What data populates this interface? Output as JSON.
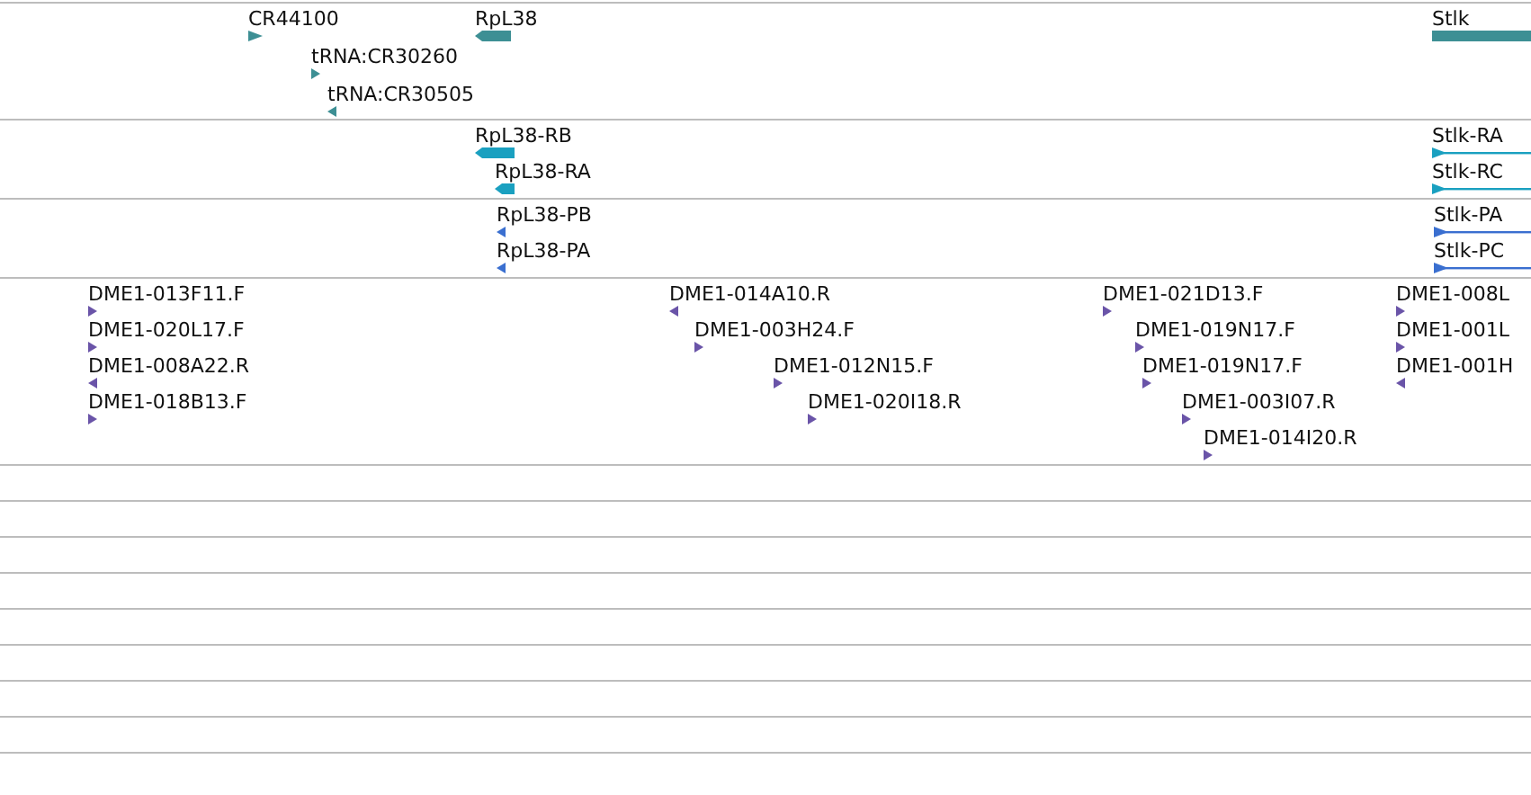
{
  "tracks": [
    {
      "kind": "gene",
      "features": [
        {
          "label": "CR44100",
          "forward": true
        },
        {
          "label": "RpL38",
          "forward": false
        },
        {
          "label": "tRNA:CR30260",
          "forward": true
        },
        {
          "label": "tRNA:CR30505",
          "forward": false
        },
        {
          "label": "Stlk",
          "forward": true
        }
      ]
    },
    {
      "kind": "transcript",
      "features": [
        {
          "label": "RpL38-RB",
          "forward": false
        },
        {
          "label": "RpL38-RA",
          "forward": false
        },
        {
          "label": "Stlk-RA",
          "forward": true
        },
        {
          "label": "Stlk-RC",
          "forward": true
        }
      ]
    },
    {
      "kind": "protein",
      "features": [
        {
          "label": "RpL38-PB",
          "forward": false
        },
        {
          "label": "RpL38-PA",
          "forward": false
        },
        {
          "label": "Stlk-PA",
          "forward": true
        },
        {
          "label": "Stlk-PC",
          "forward": true
        }
      ]
    },
    {
      "kind": "clone",
      "features": [
        {
          "label": "DME1-013F11.F",
          "forward": true
        },
        {
          "label": "DME1-020L17.F",
          "forward": true
        },
        {
          "label": "DME1-008A22.R",
          "forward": false
        },
        {
          "label": "DME1-018B13.F",
          "forward": true
        },
        {
          "label": "DME1-014A10.R",
          "forward": false
        },
        {
          "label": "DME1-003H24.F",
          "forward": true
        },
        {
          "label": "DME1-012N15.F",
          "forward": true
        },
        {
          "label": "DME1-020I18.R",
          "forward": true
        },
        {
          "label": "DME1-021D13.F",
          "forward": true
        },
        {
          "label": "DME1-019N17.F",
          "forward": true
        },
        {
          "label": "DME1-019N17.F",
          "forward": true
        },
        {
          "label": "DME1-003I07.R",
          "forward": true
        },
        {
          "label": "DME1-014I20.R",
          "forward": true
        },
        {
          "label": "DME1-008L",
          "forward": true
        },
        {
          "label": "DME1-001L",
          "forward": true
        },
        {
          "label": "DME1-001H",
          "forward": false
        }
      ]
    }
  ]
}
